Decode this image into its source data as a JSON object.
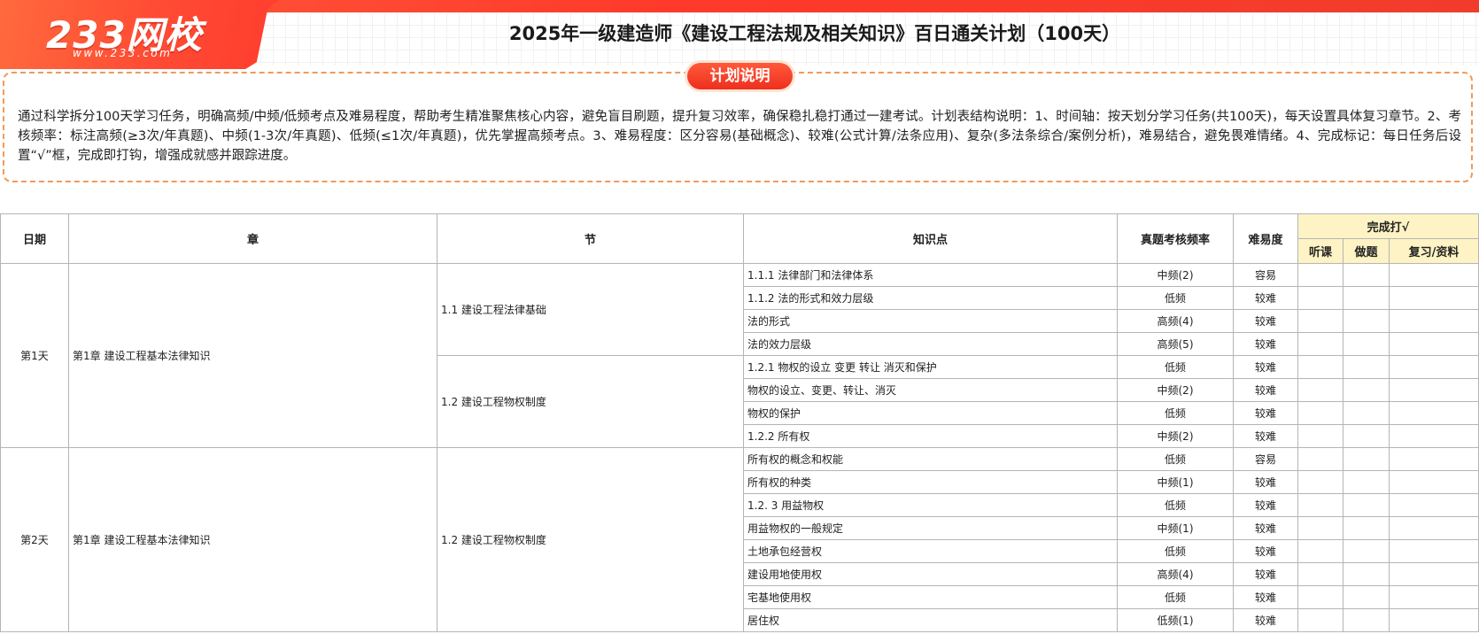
{
  "header": {
    "logo_text": "233网校",
    "logo_url": "www.233.com",
    "title": "2025年一级建造师《建设工程法规及相关知识》百日通关计划（100天）"
  },
  "note": {
    "badge": "计划说明",
    "text": "通过科学拆分100天学习任务，明确高频/中频/低频考点及难易程度，帮助考生精准聚焦核心内容，避免盲目刷题，提升复习效率，确保稳扎稳打通过一建考试。计划表结构说明：1、时间轴：按天划分学习任务(共100天)，每天设置具体复习章节。2、考核频率：标注高频(≥3次/年真题)、中频(1-3次/年真题)、低频(≤1次/年真题)，优先掌握高频考点。3、难易程度：区分容易(基础概念)、较难(公式计算/法条应用)、复杂(多法条综合/案例分析)，难易结合，避免畏难情绪。4、完成标记：每日任务后设置“√”框，完成即打钩，增强成就感并跟踪进度。"
  },
  "colors": {
    "brand_red": "#ff4b34",
    "note_border": "#f09a5a",
    "done_header_bg": "#fdf3c4"
  },
  "table": {
    "headers": {
      "date": "日期",
      "chapter": "章",
      "section": "节",
      "point": "知识点",
      "freq": "真题考核频率",
      "difficulty": "难易度",
      "done": "完成打√",
      "listen": "听课",
      "practice": "做题",
      "review": "复习/资料"
    },
    "days": [
      {
        "day": "第1天",
        "chapter": "第1章 建设工程基本法律知识",
        "sections": [
          {
            "name": "1.1 建设工程法律基础",
            "points": [
              {
                "point": "1.1.1 法律部门和法律体系",
                "freq": "中频(2)",
                "difficulty": "容易"
              },
              {
                "point": "1.1.2 法的形式和效力层级",
                "freq": "低频",
                "difficulty": "较难"
              },
              {
                "point": "法的形式",
                "freq": "高频(4)",
                "difficulty": "较难"
              },
              {
                "point": "法的效力层级",
                "freq": "高频(5)",
                "difficulty": "较难"
              }
            ]
          },
          {
            "name": "1.2 建设工程物权制度",
            "points": [
              {
                "point": "1.2.1 物权的设立 变更 转让 消灭和保护",
                "freq": "低频",
                "difficulty": "较难"
              },
              {
                "point": "物权的设立、变更、转让、消灭",
                "freq": "中频(2)",
                "difficulty": "较难"
              },
              {
                "point": "物权的保护",
                "freq": "低频",
                "difficulty": "较难"
              },
              {
                "point": "1.2.2 所有权",
                "freq": "中频(2)",
                "difficulty": "较难"
              }
            ]
          }
        ]
      },
      {
        "day": "第2天",
        "chapter": "第1章 建设工程基本法律知识",
        "sections": [
          {
            "name": "1.2 建设工程物权制度",
            "points": [
              {
                "point": "所有权的概念和权能",
                "freq": "低频",
                "difficulty": "容易"
              },
              {
                "point": "所有权的种类",
                "freq": "中频(1)",
                "difficulty": "较难"
              },
              {
                "point": "1.2. 3 用益物权",
                "freq": "低频",
                "difficulty": "较难"
              },
              {
                "point": "用益物权的一般规定",
                "freq": "中频(1)",
                "difficulty": "较难"
              },
              {
                "point": "土地承包经营权",
                "freq": "低频",
                "difficulty": "较难"
              },
              {
                "point": "建设用地使用权",
                "freq": "高频(4)",
                "difficulty": "较难"
              },
              {
                "point": "宅基地使用权",
                "freq": "低频",
                "difficulty": "较难"
              },
              {
                "point": "居住权",
                "freq": "低频(1)",
                "difficulty": "较难"
              }
            ]
          }
        ]
      }
    ]
  }
}
